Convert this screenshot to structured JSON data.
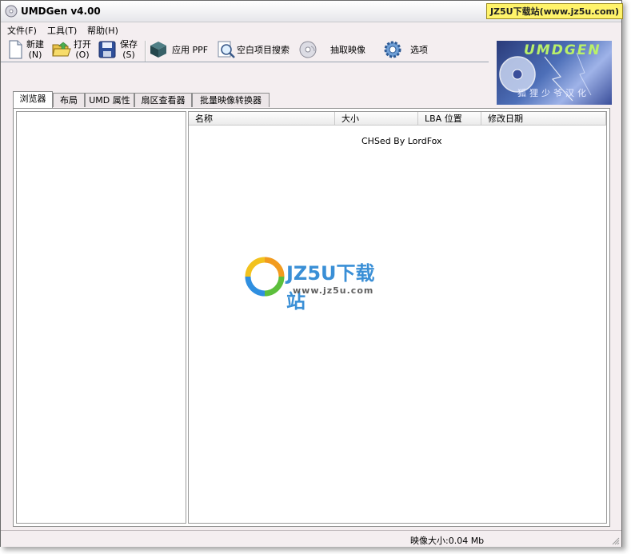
{
  "window": {
    "title": "UMDGen v4.00",
    "badge": "JZ5U下载站(www.jz5u.com)"
  },
  "menu": [
    {
      "label": "文件(F)"
    },
    {
      "label": "工具(T)"
    },
    {
      "label": "帮助(H)"
    }
  ],
  "toolbar": {
    "new_label": "新建",
    "new_key": "(N)",
    "open_label": "打开",
    "open_key": "(O)",
    "save_label": "保存",
    "save_key": "(S)",
    "apply_ppf": "应用 PPF",
    "blank_search": "空白项目搜索",
    "extract_image": "抽取映像",
    "options": "选项"
  },
  "logo": {
    "title": "UMDGEN",
    "subtitle": "狐狸少爷汉化"
  },
  "tabs": [
    {
      "label": "浏览器",
      "active": true
    },
    {
      "label": "布局"
    },
    {
      "label": "UMD 属性"
    },
    {
      "label": "扇区查看器"
    },
    {
      "label": "批量映像转换器"
    }
  ],
  "file_list": {
    "columns": [
      "名称",
      "大小",
      "LBA 位置",
      "修改日期"
    ],
    "credit": "CHSed By LordFox"
  },
  "watermark": {
    "brand": "JZ5U下载站",
    "url": "www.jz5u.com"
  },
  "status": {
    "image_size": "映像大小:0.04 Mb"
  },
  "colors": {
    "window_bg": "#f4eef0",
    "accent_blue": "#3a8fd6",
    "badge_yellow": "#fff36a"
  }
}
